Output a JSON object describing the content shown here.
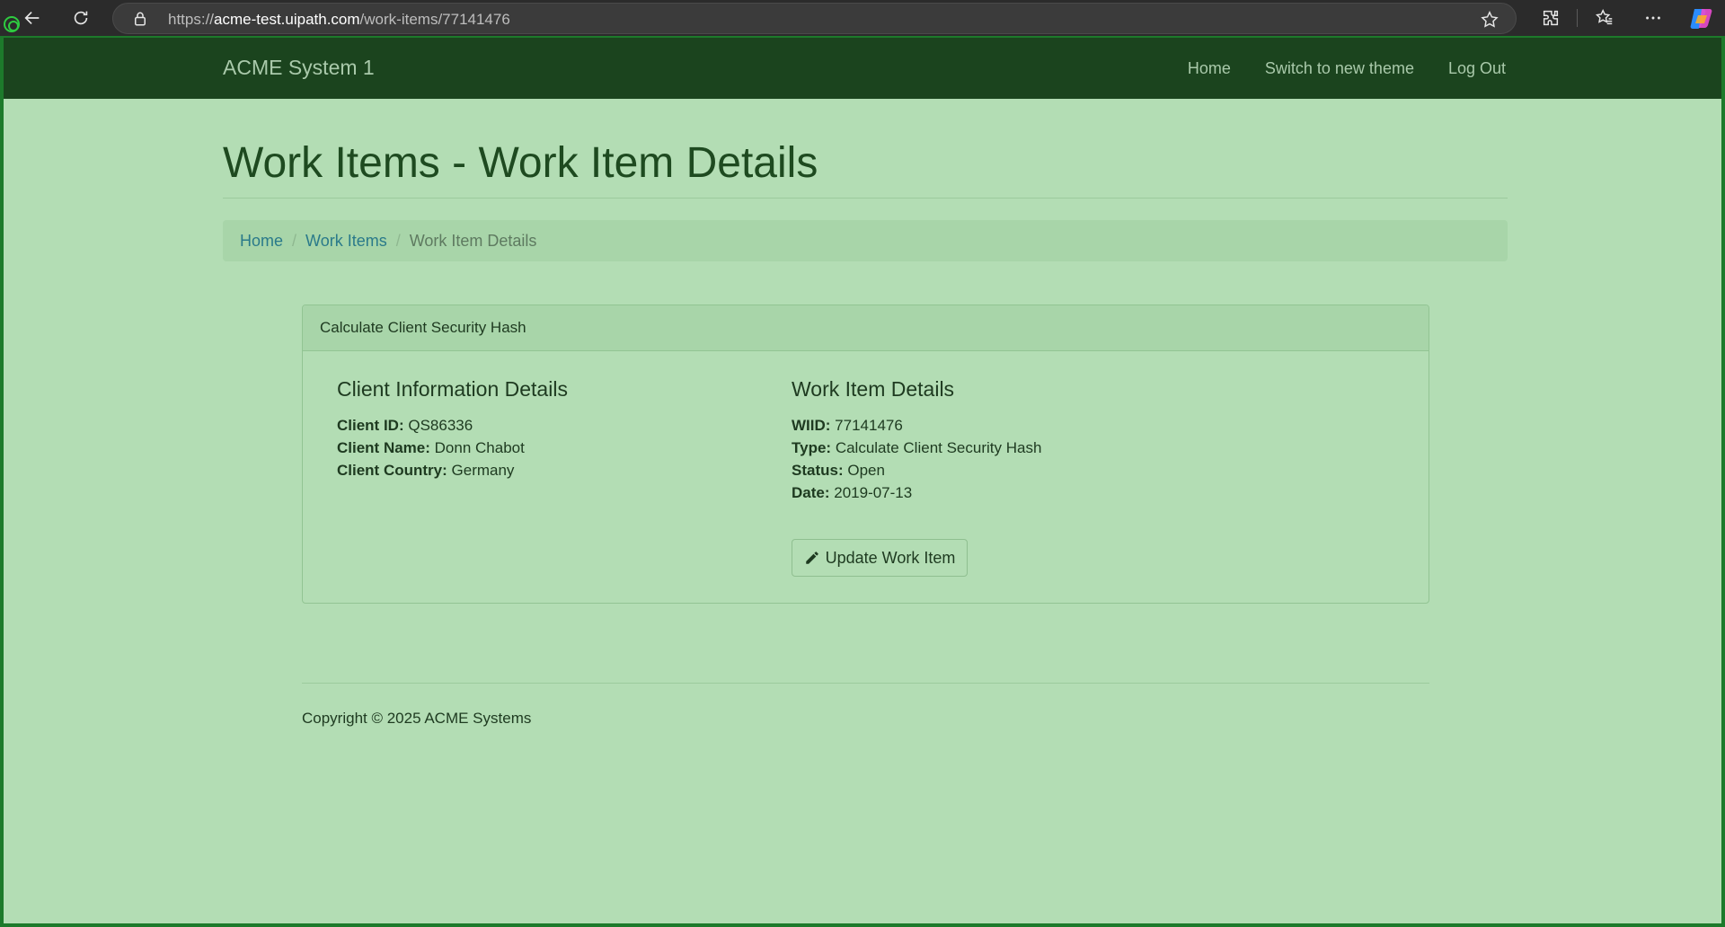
{
  "browser": {
    "url_scheme": "https://",
    "url_host": "acme-test.uipath.com",
    "url_path": "/work-items/77141476"
  },
  "navbar": {
    "brand": "ACME System 1",
    "links": [
      "Home",
      "Switch to new theme",
      "Log Out"
    ]
  },
  "page": {
    "title": "Work Items - Work Item Details"
  },
  "breadcrumb": {
    "home": "Home",
    "separator": "/",
    "work_items": "Work Items",
    "current": "Work Item Details"
  },
  "panel": {
    "heading": "Calculate Client Security Hash",
    "client": {
      "title": "Client Information Details",
      "id_label": "Client ID:",
      "id_value": "QS86336",
      "name_label": "Client Name:",
      "name_value": "Donn Chabot",
      "country_label": "Client Country:",
      "country_value": "Germany"
    },
    "work_item": {
      "title": "Work Item Details",
      "wiid_label": "WIID:",
      "wiid_value": "77141476",
      "type_label": "Type:",
      "type_value": "Calculate Client Security Hash",
      "status_label": "Status:",
      "status_value": "Open",
      "date_label": "Date:",
      "date_value": "2019-07-13"
    },
    "update_button": "Update Work Item"
  },
  "footer": {
    "copyright": "Copyright © 2025 ACME Systems"
  }
}
